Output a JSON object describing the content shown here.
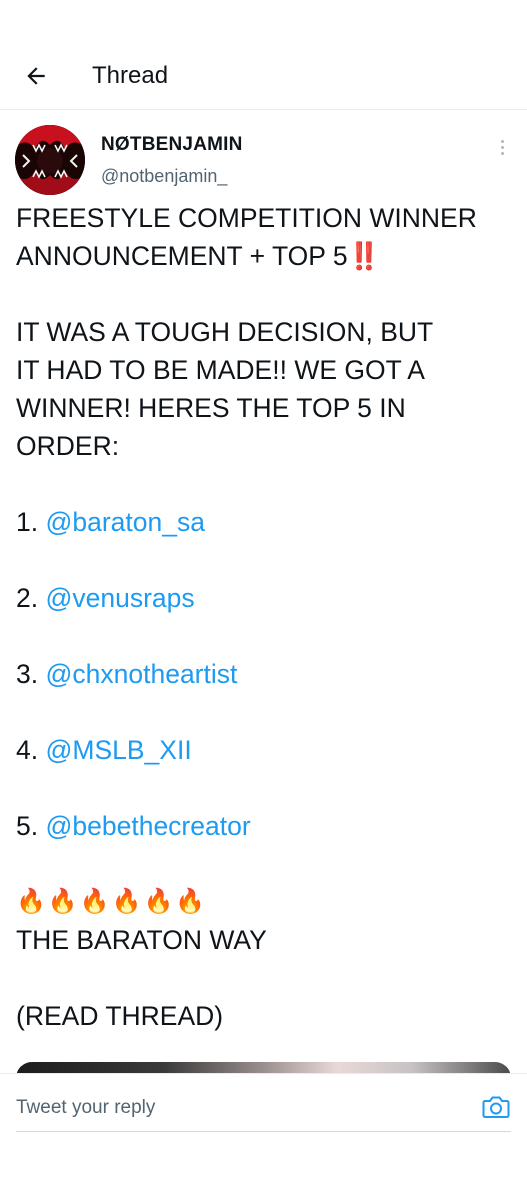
{
  "header": {
    "title": "Thread",
    "back_icon": "arrow-left-icon"
  },
  "tweet": {
    "author": {
      "display_name": "NØTBENJAMIN",
      "handle": "@notbenjamin_"
    },
    "lines": {
      "headline_1": "FREESTYLE COMPETITION WINNER",
      "headline_2": "ANNOUNCEMENT + TOP 5",
      "headline_emoji": "‼️",
      "para_1": "IT WAS A TOUGH DECISION, BUT",
      "para_2": "IT HAD TO BE MADE!! WE GOT A",
      "para_3": "WINNER! HERES THE TOP 5 IN",
      "para_4": "ORDER:",
      "fire": "🔥🔥🔥🔥🔥🔥",
      "tagline": "THE BARATON WAY",
      "read_thread": "(READ THREAD)"
    },
    "rankings": [
      {
        "rank": "1.",
        "mention": "@baraton_sa"
      },
      {
        "rank": "2.",
        "mention": "@venusraps"
      },
      {
        "rank": "3.",
        "mention": "@chxnotheartist"
      },
      {
        "rank": "4.",
        "mention": "@MSLB_XII"
      },
      {
        "rank": "5.",
        "mention": "@bebethecreator"
      }
    ]
  },
  "reply": {
    "placeholder": "Tweet your reply",
    "camera_icon": "camera-icon"
  },
  "colors": {
    "link": "#1d9bf0",
    "text": "#0f1419",
    "secondary": "#536471"
  }
}
